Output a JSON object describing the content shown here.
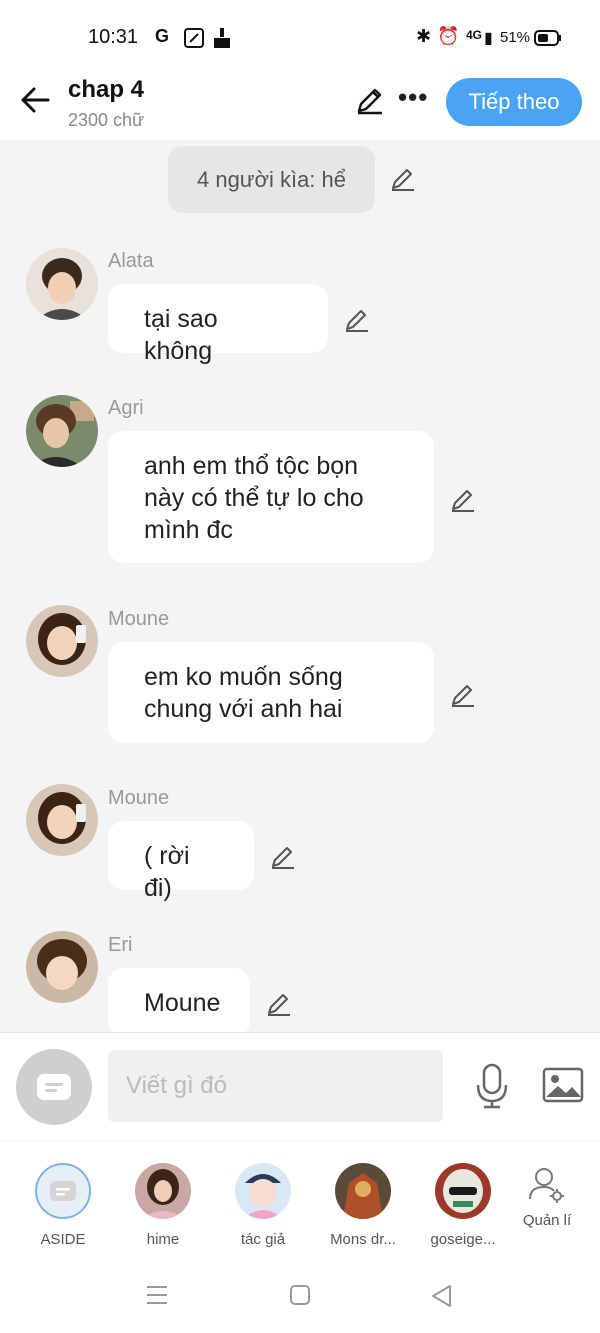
{
  "status": {
    "time": "10:31",
    "network": "4G",
    "battery": "51%"
  },
  "header": {
    "title": "chap 4",
    "subtitle": "2300 chữ",
    "next_label": "Tiếp theo"
  },
  "narration": "4 người kìa: hể",
  "messages": [
    {
      "name": "Alata",
      "text": "tại sao không"
    },
    {
      "name": "Agri",
      "lines": [
        "anh em thổ tộc bọn",
        "này có thể tự lo cho",
        "mình đc"
      ]
    },
    {
      "name": "Moune",
      "lines": [
        "em ko muốn sống",
        "chung với anh hai"
      ]
    },
    {
      "name": "Moune",
      "text": "( rời đi)"
    },
    {
      "name": "Eri",
      "text": "Moune"
    }
  ],
  "composer": {
    "placeholder": "Viết gì đó"
  },
  "characters": [
    {
      "label": "ASIDE"
    },
    {
      "label": "hime"
    },
    {
      "label": "tác giả"
    },
    {
      "label": "Mons dr..."
    },
    {
      "label": "goseige..."
    },
    {
      "label": "Quản lí"
    }
  ],
  "colors": {
    "accent": "#4aa3f5",
    "background": "#f4f4f4"
  }
}
